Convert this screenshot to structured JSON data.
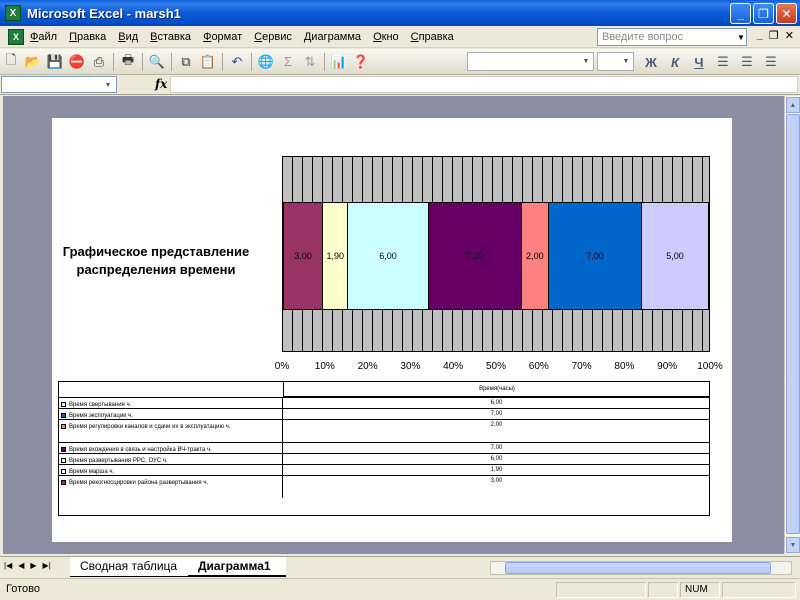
{
  "window": {
    "title": "Microsoft Excel - marsh1"
  },
  "menu": {
    "items": [
      "Файл",
      "Правка",
      "Вид",
      "Вставка",
      "Формат",
      "Сервис",
      "Диаграмма",
      "Окно",
      "Справка"
    ],
    "help_placeholder": "Введите вопрос"
  },
  "toolbar": {
    "bold": "Ж",
    "italic": "К",
    "underline": "Ч"
  },
  "chart": {
    "title_line1": "Графическое представление",
    "title_line2": "распределения времени"
  },
  "chart_data": {
    "type": "bar",
    "orientation": "horizontal-stacked-100",
    "title": "Графическое представление распределения времени",
    "x_ticks": [
      "0%",
      "10%",
      "20%",
      "30%",
      "40%",
      "50%",
      "60%",
      "70%",
      "80%",
      "90%",
      "100%"
    ],
    "xlim": [
      0,
      100
    ],
    "series": [
      {
        "name": "Время марша ч.",
        "value": 3.0,
        "label": "3,00",
        "color": "#993366"
      },
      {
        "name": "Время развертывания РРС, ОУС ч.",
        "value": 1.9,
        "label": "1,90",
        "color": "#ffffcc"
      },
      {
        "name": "Время свертывания ч.",
        "value": 6.0,
        "label": "6,00",
        "color": "#ccffff"
      },
      {
        "name": "Время вхождения в связь и настройка ВЧ-тракта ч.",
        "value": 7.0,
        "label": "7,00",
        "color": "#660066"
      },
      {
        "name": "Время регулировки каналов и сдачи их в эксплуатацию ч.",
        "value": 2.0,
        "label": "2,00",
        "color": "#ff8080"
      },
      {
        "name": "Время эксплуатации ч.",
        "value": 7.0,
        "label": "7,00",
        "color": "#0066cc"
      },
      {
        "name": "Время рекогносцировки района развертывания ч.",
        "value": 5.0,
        "label": "5,00",
        "color": "#ccccff"
      }
    ]
  },
  "data_table": {
    "header": "Время(часы)",
    "rows": [
      {
        "label": "Время свертывания ч.",
        "value": "6,00",
        "color": "#ccffff"
      },
      {
        "label": "Время эксплуатации ч.",
        "value": "7,00",
        "color": "#0066cc"
      },
      {
        "label": "Время регулировки каналов и сдачи их в эксплуатацию ч.",
        "value": "2,00",
        "color": "#ff8080"
      },
      {
        "label": "Время вхождения в связь и настройка ВЧ-тракта ч.",
        "value": "7,00",
        "color": "#660066"
      },
      {
        "label": "Время развертывания РРС, ОУС ч.",
        "value": "6,00",
        "color": "#ffffcc"
      },
      {
        "label": "Время марша ч.",
        "value": "1,90",
        "color": "#ffffff"
      },
      {
        "label": "Время рекогносцировки района развертывания ч.",
        "value": "3,00",
        "color": "#993366"
      }
    ]
  },
  "sheet_tabs": [
    "Сводная таблица",
    "Диаграмма1"
  ],
  "status": {
    "text": "Готово",
    "num": "NUM"
  }
}
